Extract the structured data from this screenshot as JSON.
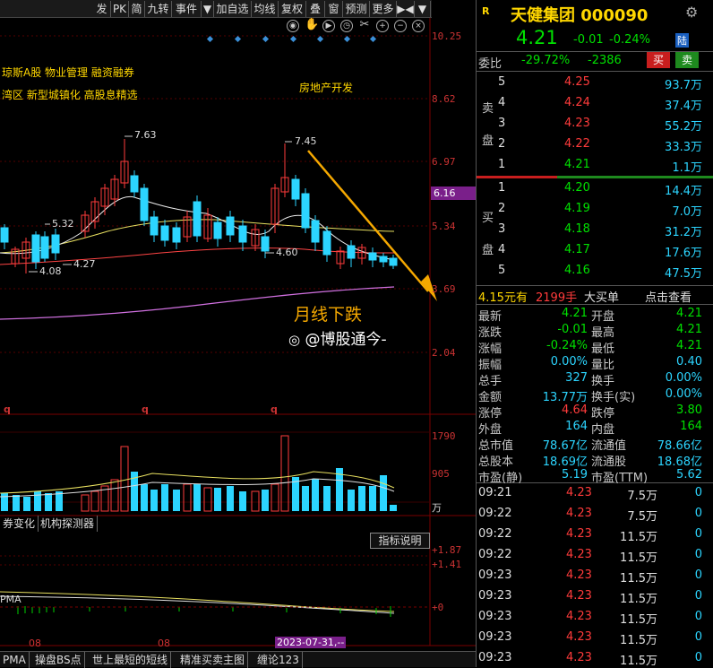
{
  "toolbar": {
    "items": [
      "发",
      "PK",
      "简",
      "九转",
      "事件",
      "▼",
      "加自选",
      "均线",
      "复权",
      "叠",
      "窗",
      "预测",
      "更多",
      "▶◀",
      "▼"
    ]
  },
  "chart": {
    "y_labels": [
      "10.25",
      "8.62",
      "6.97",
      "5.34",
      "3.69",
      "2.04"
    ],
    "price_tag": "6.16",
    "tags_line1": "琼斯A股  物业管理  融资融券",
    "tags_line2": "湾区  新型城镇化  高股息精选",
    "sector": "房地产开发",
    "ann_high1": "7.63",
    "ann_high2": "7.45",
    "ann_low1": "4.08",
    "ann_low2": "4.27",
    "ann_low3": "4.60",
    "ann_mid": "5.32",
    "q": "q",
    "annotation_text": "月线下跌",
    "watermark": "@博股通今-",
    "vol_labels": [
      "1790",
      "905",
      "万"
    ],
    "indicator_labels": [
      "+1.87",
      "+1.41",
      "+0"
    ],
    "indicator_btn": "指标说明",
    "dates": [
      "08",
      "08",
      "2023-07-31,--"
    ],
    "tabs_mid": [
      "券变化",
      "机构探测器"
    ],
    "tabs_bottom": [
      "PMA",
      "操盘BS点",
      "世上最短的短线",
      "精准买卖主图",
      "缠论123"
    ],
    "pma_label": "PMA"
  },
  "quote": {
    "badge": "R",
    "name": "天健集团 000090",
    "price": "4.21",
    "change": "-0.01",
    "pct": "-0.24%",
    "market": "陆",
    "webi_label": "委比",
    "webi": "-29.72%",
    "weicha": "-2386",
    "buy_btn": "买",
    "sell_btn": "卖",
    "sell_label": [
      "卖",
      "盘"
    ],
    "buy_label": [
      "买",
      "盘"
    ],
    "asks": [
      [
        "5",
        "4.25",
        "93.7万"
      ],
      [
        "4",
        "4.24",
        "37.4万"
      ],
      [
        "3",
        "4.23",
        "55.2万"
      ],
      [
        "2",
        "4.22",
        "33.3万"
      ],
      [
        "1",
        "4.21",
        "1.1万"
      ]
    ],
    "bids": [
      [
        "1",
        "4.20",
        "14.4万"
      ],
      [
        "2",
        "4.19",
        "7.0万"
      ],
      [
        "3",
        "4.18",
        "31.2万"
      ],
      [
        "4",
        "4.17",
        "17.6万"
      ],
      [
        "5",
        "4.16",
        "47.5万"
      ]
    ],
    "big_order": {
      "price": "4.15元有",
      "qty": "2199手",
      "label": "大买单",
      "link": "点击查看"
    },
    "stats": [
      [
        "最新",
        "4.21",
        "开盘",
        "4.21"
      ],
      [
        "涨跌",
        "-0.01",
        "最高",
        "4.21"
      ],
      [
        "涨幅",
        "-0.24%",
        "最低",
        "4.21"
      ],
      [
        "振幅",
        "0.00%",
        "量比",
        "0.40"
      ],
      [
        "总手",
        "327",
        "换手",
        "0.00%"
      ],
      [
        "金额",
        "13.77万",
        "换手(实)",
        "0.00%"
      ],
      [
        "涨停",
        "4.64",
        "跌停",
        "3.80"
      ],
      [
        "外盘",
        "164",
        "内盘",
        "164"
      ],
      [
        "总市值",
        "78.67亿",
        "流通值",
        "78.66亿"
      ],
      [
        "总股本",
        "18.69亿",
        "流通股",
        "18.68亿"
      ],
      [
        "市盈(静)",
        "5.19",
        "市盈(TTM)",
        "5.62"
      ]
    ],
    "ticks": [
      [
        "09:21",
        "4.23",
        "7.5万",
        "0"
      ],
      [
        "09:22",
        "4.23",
        "7.5万",
        "0"
      ],
      [
        "09:22",
        "4.23",
        "11.5万",
        "0"
      ],
      [
        "09:22",
        "4.23",
        "11.5万",
        "0"
      ],
      [
        "09:23",
        "4.23",
        "11.5万",
        "0"
      ],
      [
        "09:23",
        "4.23",
        "11.5万",
        "0"
      ],
      [
        "09:23",
        "4.23",
        "11.5万",
        "0"
      ],
      [
        "09:23",
        "4.23",
        "11.5万",
        "0"
      ],
      [
        "09:23",
        "4.23",
        "11.5万",
        "0"
      ]
    ]
  },
  "colors": {
    "up": "#ff3b3b",
    "down": "#2cd5ff",
    "accent": "#ffd700",
    "bg": "#000000"
  }
}
